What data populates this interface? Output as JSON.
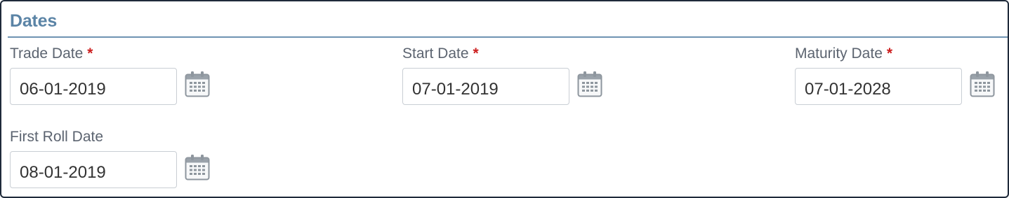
{
  "section": {
    "title": "Dates",
    "accent_color": "#5b84a6",
    "required_color": "#cc1f1f"
  },
  "fields": {
    "trade_date": {
      "label": "Trade Date",
      "required_marker": "*",
      "value": "06-01-2019",
      "icon": "calendar-icon"
    },
    "start_date": {
      "label": "Start Date",
      "required_marker": "*",
      "value": "07-01-2019",
      "icon": "calendar-icon"
    },
    "maturity_date": {
      "label": "Maturity Date",
      "required_marker": "*",
      "value": "07-01-2028",
      "icon": "calendar-icon"
    },
    "first_roll_date": {
      "label": "First Roll Date",
      "value": "08-01-2019",
      "icon": "calendar-icon"
    }
  }
}
